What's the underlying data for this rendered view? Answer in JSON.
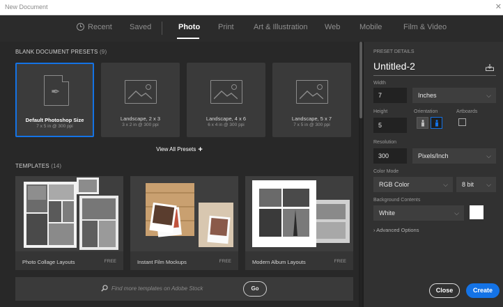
{
  "window": {
    "title": "New Document"
  },
  "tabs": [
    {
      "label": "Recent"
    },
    {
      "label": "Saved"
    },
    {
      "label": "Photo",
      "active": true
    },
    {
      "label": "Print"
    },
    {
      "label": "Art & Illustration"
    },
    {
      "label": "Web"
    },
    {
      "label": "Mobile"
    },
    {
      "label": "Film & Video"
    }
  ],
  "presets_section": {
    "title": "BLANK DOCUMENT PRESETS",
    "count": "(9)"
  },
  "presets": [
    {
      "name": "Default Photoshop Size",
      "size": "7 x 5 in @ 300 ppi",
      "selected": true
    },
    {
      "name": "Landscape, 2 x 3",
      "size": "3 x 2 in @ 300 ppi"
    },
    {
      "name": "Landscape, 4 x 6",
      "size": "6 x 4 in @ 300 ppi"
    },
    {
      "name": "Landscape, 5 x 7",
      "size": "7 x 5 in @ 300 ppi"
    }
  ],
  "view_all_label": "View All Presets",
  "templates_section": {
    "title": "TEMPLATES",
    "count": "(14)"
  },
  "templates": [
    {
      "name": "Photo Collage Layouts",
      "badge": "FREE"
    },
    {
      "name": "Instant Film Mockups",
      "badge": "FREE"
    },
    {
      "name": "Modern Album Layouts",
      "badge": "FREE"
    }
  ],
  "stock_search": {
    "placeholder": "Find more templates on Adobe Stock",
    "go_label": "Go"
  },
  "details": {
    "header": "PRESET DETAILS",
    "doc_name": "Untitled-2",
    "width_label": "Width",
    "width_value": "7",
    "width_unit": "Inches",
    "height_label": "Height",
    "height_value": "5",
    "orientation_label": "Orientation",
    "orientation": "landscape",
    "artboards_label": "Artboards",
    "artboards_checked": false,
    "resolution_label": "Resolution",
    "resolution_value": "300",
    "resolution_unit": "Pixels/Inch",
    "color_mode_label": "Color Mode",
    "color_mode": "RGB Color",
    "bit_depth": "8 bit",
    "background_label": "Background Contents",
    "background": "White",
    "advanced_label": "Advanced Options",
    "close_label": "Close",
    "create_label": "Create"
  },
  "colors": {
    "accent": "#1473e6",
    "background": "#ffffff"
  }
}
